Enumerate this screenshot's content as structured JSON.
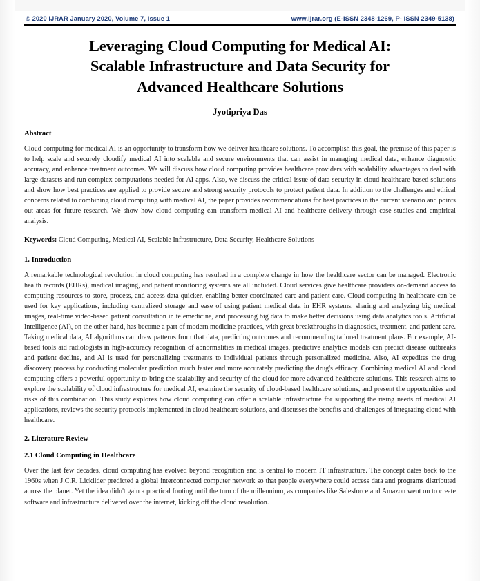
{
  "header": {
    "left": "© 2020 IJRAR January 2020, Volume 7, Issue 1",
    "right": "www.ijrar.org (E-ISSN 2348-1269, P- ISSN 2349-5138)",
    "accent_color": "#1f3d7a",
    "rule_color": "#000000"
  },
  "title": {
    "line1": "Leveraging Cloud Computing for Medical AI:",
    "line2": "Scalable Infrastructure and Data Security for",
    "line3": "Advanced Healthcare Solutions"
  },
  "author": "Jyotipriya Das",
  "abstract": {
    "heading": "Abstract",
    "text": "Cloud computing for medical AI is an opportunity to transform how we deliver healthcare solutions. To accomplish this goal, the premise of this paper is to help scale and securely cloudify medical AI into scalable and secure environments that can assist in managing medical data, enhance diagnostic accuracy, and enhance treatment outcomes. We will discuss how cloud computing provides healthcare providers with scalability advantages to deal with large datasets and run complex computations needed for AI apps. Also, we discuss the critical issue of data security in cloud healthcare-based solutions and show how best practices are applied to provide secure and strong security protocols to protect patient data. In addition to the challenges and ethical concerns related to combining cloud computing with medical AI, the paper provides recommendations for best practices in the current scenario and points out areas for future research. We show how cloud computing can transform medical AI and healthcare delivery through case studies and empirical analysis."
  },
  "keywords": {
    "label": "Keywords:",
    "value": "Cloud Computing, Medical AI, Scalable Infrastructure, Data Security, Healthcare Solutions"
  },
  "introduction": {
    "heading": "1. Introduction",
    "text": "A remarkable technological revolution in cloud computing has resulted in a complete change in how the healthcare sector can be managed. Electronic health records (EHRs), medical imaging, and patient monitoring systems are all included. Cloud services give healthcare providers on-demand access to computing resources to store, process, and access data quicker, enabling better coordinated care and patient care. Cloud computing in healthcare can be used for key applications, including centralized storage and ease of using patient medical data in EHR systems, sharing and analyzing big medical images, real-time video-based patient consultation in telemedicine, and processing big data to make better decisions using data analytics tools. Artificial Intelligence (AI), on the other hand, has become a part of modern medicine practices, with great breakthroughs in diagnostics, treatment, and patient care. Taking medical data, AI algorithms can draw patterns from that data, predicting outcomes and recommending tailored treatment plans. For example, AI-based tools aid radiologists in high-accuracy recognition of abnormalities in medical images, predictive analytics models can predict disease outbreaks and patient decline, and AI is used for personalizing treatments to individual patients through personalized medicine. Also, AI expedites the drug discovery process by conducting molecular prediction much faster and more accurately predicting the drug's efficacy. Combining medical AI and cloud computing offers a powerful opportunity to bring the scalability and security of the cloud for more advanced healthcare solutions. This research aims to explore the scalability of cloud infrastructure for medical AI, examine the security of cloud-based healthcare solutions, and present the opportunities and risks of this combination. This study explores how cloud computing can offer a scalable infrastructure for supporting the rising needs of medical AI applications, reviews the security protocols implemented in cloud healthcare solutions, and discusses the benefits and challenges of integrating cloud with healthcare."
  },
  "literature_review": {
    "heading": "2. Literature Review",
    "subheading": "2.1 Cloud Computing in Healthcare",
    "text": "Over the last few decades, cloud computing has evolved beyond recognition and is central to modern IT infrastructure. The concept dates back to the 1960s when J.C.R. Licklider predicted a global interconnected computer network so that people everywhere could access data and programs distributed across the planet. Yet the idea didn't gain a practical footing until the turn of the millennium, as companies like Salesforce and Amazon went on to create software and infrastructure delivered over the internet, kicking off the cloud revolution."
  }
}
